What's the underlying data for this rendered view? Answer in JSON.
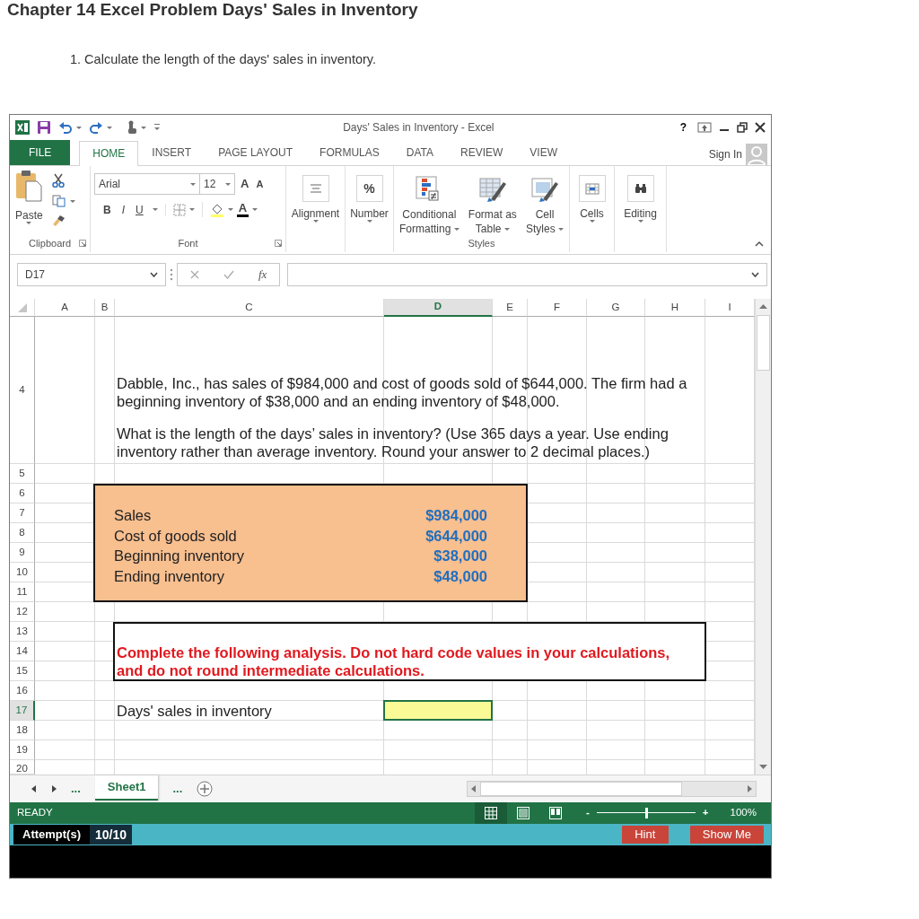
{
  "page": {
    "heading": "Chapter 14 Excel Problem Days' Sales in Inventory",
    "question": "1. Calculate the length of the days' sales in inventory."
  },
  "window": {
    "title": "Days' Sales in Inventory - Excel",
    "help": "?",
    "sign_in": "Sign In"
  },
  "ribbon_tabs": [
    {
      "label": "FILE",
      "kind": "file",
      "selected": false
    },
    {
      "label": "HOME",
      "kind": "tab",
      "selected": true
    },
    {
      "label": "INSERT",
      "kind": "tab",
      "selected": false
    },
    {
      "label": "PAGE LAYOUT",
      "kind": "tab",
      "selected": false
    },
    {
      "label": "FORMULAS",
      "kind": "tab",
      "selected": false
    },
    {
      "label": "DATA",
      "kind": "tab",
      "selected": false
    },
    {
      "label": "REVIEW",
      "kind": "tab",
      "selected": false
    },
    {
      "label": "VIEW",
      "kind": "tab",
      "selected": false
    }
  ],
  "ribbon": {
    "paste": "Paste",
    "clipboard_group": "Clipboard",
    "font_name": "Arial",
    "font_size": "12",
    "size_buttons": [
      "A",
      "A"
    ],
    "style_buttons": [
      "B",
      "I",
      "U"
    ],
    "font_color": "A",
    "font_group": "Font",
    "alignment": "Alignment",
    "number_symbol": "%",
    "number": "Number",
    "styles": [
      {
        "lines": [
          "Conditional",
          "Formatting"
        ],
        "kind": "conditional"
      },
      {
        "lines": [
          "Format as",
          "Table"
        ],
        "kind": "table"
      },
      {
        "lines": [
          "Cell",
          "Styles"
        ],
        "kind": "cell-styles"
      }
    ],
    "styles_group": "Styles",
    "cells": "Cells",
    "editing": "Editing"
  },
  "formula_bar": {
    "name_box": "D17",
    "function_symbol": "fx"
  },
  "sheet": {
    "columns": [
      {
        "label": "A",
        "selected": false
      },
      {
        "label": "B",
        "selected": false
      },
      {
        "label": "C",
        "selected": false
      },
      {
        "label": "D",
        "selected": true
      },
      {
        "label": "E",
        "selected": false
      },
      {
        "label": "F",
        "selected": false
      },
      {
        "label": "G",
        "selected": false
      },
      {
        "label": "H",
        "selected": false
      },
      {
        "label": "I",
        "selected": false
      }
    ],
    "rows": [
      {
        "label": "4",
        "selected": false
      },
      {
        "label": "5",
        "selected": false
      },
      {
        "label": "6",
        "selected": false
      },
      {
        "label": "7",
        "selected": false
      },
      {
        "label": "8",
        "selected": false
      },
      {
        "label": "9",
        "selected": false
      },
      {
        "label": "10",
        "selected": false
      },
      {
        "label": "11",
        "selected": false
      },
      {
        "label": "12",
        "selected": false
      },
      {
        "label": "13",
        "selected": false
      },
      {
        "label": "14",
        "selected": false
      },
      {
        "label": "15",
        "selected": false
      },
      {
        "label": "16",
        "selected": false
      },
      {
        "label": "17",
        "selected": true
      },
      {
        "label": "18",
        "selected": false
      },
      {
        "label": "19",
        "selected": false
      },
      {
        "label": "20",
        "selected": false
      }
    ],
    "problem": [
      "Dabble, Inc., has sales of $984,000 and cost of goods sold of $644,000. The firm had a beginning inventory of $38,000 and an ending inventory of $48,000.",
      "What is the length of the days’ sales in inventory? (Use 365 days a year. Use ending inventory rather than average inventory. Round your answer to 2 decimal places.)"
    ],
    "data": [
      {
        "label": "Sales",
        "value": "$984,000"
      },
      {
        "label": "Cost of goods sold",
        "value": "$644,000"
      },
      {
        "label": "Beginning inventory",
        "value": "$38,000"
      },
      {
        "label": "Ending inventory",
        "value": "$48,000"
      }
    ],
    "instructions": "Complete the following analysis. Do not hard code values in your calculations, and do not round intermediate calculations.",
    "answer_label": "Days' sales in inventory",
    "answer_cell": {
      "selected": true
    }
  },
  "sheet_tabs": {
    "more_left": "...",
    "tabs": [
      {
        "label": "Sheet1",
        "selected": true
      }
    ],
    "more_right": "..."
  },
  "status_bar": {
    "mode": "READY",
    "views": [
      {
        "kind": "normal",
        "selected": true
      },
      {
        "kind": "page-layout",
        "selected": false
      },
      {
        "kind": "page-break",
        "selected": false
      }
    ],
    "zoom_out": "-",
    "zoom": {
      "level": 0.5
    },
    "zoom_in": "+",
    "zoom_label": "100%"
  },
  "attempts": {
    "label": "Attempt(s)",
    "value": "10/10"
  },
  "buttons": [
    "Hint",
    "Show Me"
  ]
}
